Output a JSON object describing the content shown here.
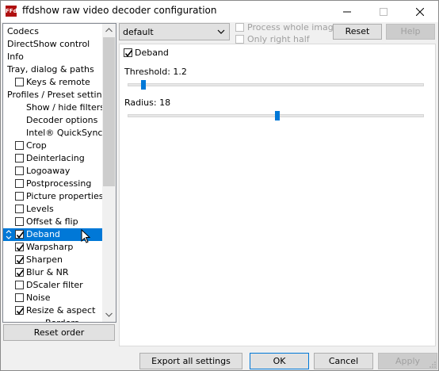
{
  "window": {
    "title": "ffdshow raw video decoder configuration",
    "icon_text": "FFds",
    "controls": {
      "minimize": "—",
      "maximize": "☐",
      "close": "✕"
    }
  },
  "tree": {
    "items": [
      {
        "label": "Codecs",
        "checkbox": null,
        "indent": 0
      },
      {
        "label": "DirectShow control",
        "checkbox": null,
        "indent": 0
      },
      {
        "label": "Info",
        "checkbox": null,
        "indent": 0
      },
      {
        "label": "Tray, dialog & paths",
        "checkbox": null,
        "indent": 0
      },
      {
        "label": "Keys & remote",
        "checkbox": false,
        "indent": 1
      },
      {
        "label": "Profiles / Preset settings",
        "checkbox": null,
        "indent": 0
      },
      {
        "label": "Show / hide filters",
        "checkbox": null,
        "indent": 1
      },
      {
        "label": "Decoder options",
        "checkbox": null,
        "indent": 1
      },
      {
        "label": "Intel® QuickSync",
        "checkbox": null,
        "indent": 1
      },
      {
        "label": "Crop",
        "checkbox": false,
        "indent": 1
      },
      {
        "label": "Deinterlacing",
        "checkbox": false,
        "indent": 1
      },
      {
        "label": "Logoaway",
        "checkbox": false,
        "indent": 1
      },
      {
        "label": "Postprocessing",
        "checkbox": false,
        "indent": 1
      },
      {
        "label": "Picture properties",
        "checkbox": false,
        "indent": 1
      },
      {
        "label": "Levels",
        "checkbox": false,
        "indent": 1
      },
      {
        "label": "Offset & flip",
        "checkbox": false,
        "indent": 1
      },
      {
        "label": "Deband",
        "checkbox": true,
        "indent": 1,
        "selected": true
      },
      {
        "label": "Warpsharp",
        "checkbox": true,
        "indent": 1
      },
      {
        "label": "Sharpen",
        "checkbox": true,
        "indent": 1
      },
      {
        "label": "Blur & NR",
        "checkbox": true,
        "indent": 1
      },
      {
        "label": "DScaler filter",
        "checkbox": false,
        "indent": 1
      },
      {
        "label": "Noise",
        "checkbox": false,
        "indent": 1
      },
      {
        "label": "Resize & aspect",
        "checkbox": true,
        "indent": 1
      },
      {
        "label": "Borders",
        "checkbox": null,
        "indent": 2
      }
    ],
    "scroll_position": 0.0
  },
  "reset_order_label": "Reset order",
  "preset": {
    "selected": "default",
    "process_whole_image": "Process whole image",
    "only_right_half": "Only right half",
    "reset_label": "Reset",
    "help_label": "Help"
  },
  "deband": {
    "enable_label": "Deband",
    "enabled": true,
    "threshold_label": "Threshold: 1.2",
    "threshold_value": 1.2,
    "threshold_fraction": 0.04,
    "radius_label": "Radius: 18",
    "radius_value": 18,
    "radius_fraction": 0.5
  },
  "buttons": {
    "export_all": "Export all settings",
    "ok": "OK",
    "cancel": "Cancel",
    "apply": "Apply"
  },
  "colors": {
    "selection": "#0078d7",
    "slider_thumb": "#0078d7",
    "disabled_text": "#a0a0a0"
  }
}
